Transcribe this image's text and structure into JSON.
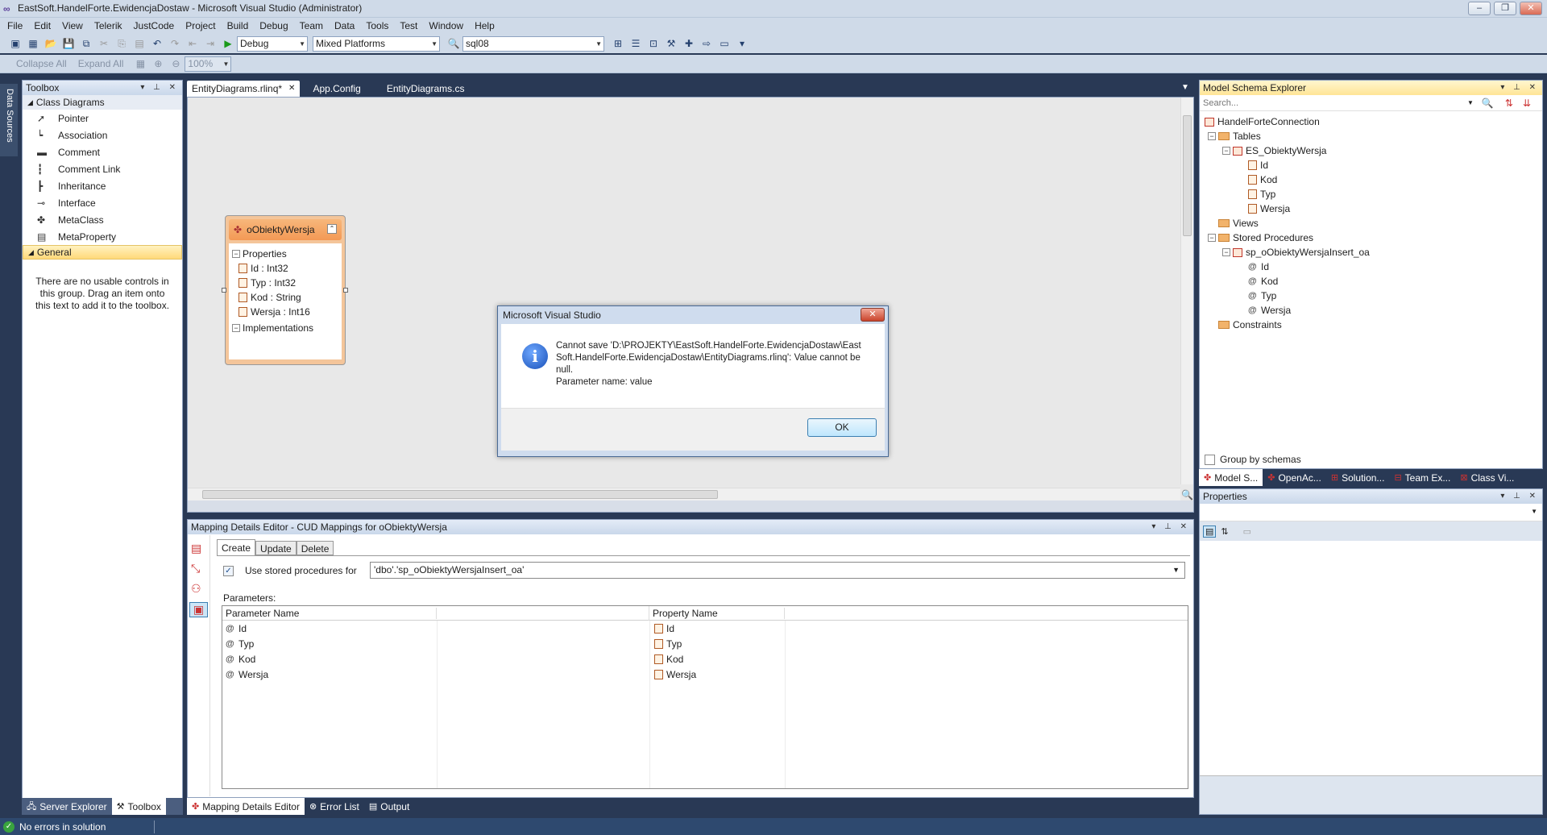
{
  "window": {
    "title": "EastSoft.HandelForte.EwidencjaDostaw - Microsoft Visual Studio (Administrator)",
    "controls": [
      "–",
      "❐",
      "✕"
    ]
  },
  "menu": [
    "File",
    "Edit",
    "View",
    "Telerik",
    "JustCode",
    "Project",
    "Build",
    "Debug",
    "Team",
    "Data",
    "Tools",
    "Test",
    "Window",
    "Help"
  ],
  "toolbar": {
    "config": "Debug",
    "platform": "Mixed Platforms",
    "search": "sql08",
    "collapse_all": "Collapse All",
    "expand_all": "Expand All",
    "zoom": "100%"
  },
  "side_strip": {
    "label": "Data Sources"
  },
  "toolbox": {
    "title": "Toolbox",
    "group1": "Class Diagrams",
    "items": [
      {
        "icon": "pointer-icon",
        "glyph": "➚",
        "label": "Pointer"
      },
      {
        "icon": "association-icon",
        "glyph": "┕",
        "label": "Association"
      },
      {
        "icon": "comment-icon",
        "glyph": "▬",
        "label": "Comment"
      },
      {
        "icon": "comment-link-icon",
        "glyph": "┇",
        "label": "Comment Link"
      },
      {
        "icon": "inheritance-icon",
        "glyph": "┣",
        "label": "Inheritance"
      },
      {
        "icon": "interface-icon",
        "glyph": "⊸",
        "label": "Interface"
      },
      {
        "icon": "metaclass-icon",
        "glyph": "✤",
        "label": "MetaClass"
      },
      {
        "icon": "metaproperty-icon",
        "glyph": "▤",
        "label": "MetaProperty"
      }
    ],
    "group2": "General",
    "empty_text": "There are no usable controls in this group. Drag an item onto this text to add it to the toolbox.",
    "bottom_tabs": [
      "Server Explorer",
      "Toolbox"
    ]
  },
  "doc_tabs": [
    {
      "label": "EntityDiagrams.rlinq*",
      "active": true
    },
    {
      "label": "App.Config",
      "active": false
    },
    {
      "label": "EntityDiagrams.cs",
      "active": false
    }
  ],
  "entity": {
    "name": "oObiektyWersja",
    "properties_label": "Properties",
    "properties": [
      "Id : Int32",
      "Typ : Int32",
      "Kod : String",
      "Wersja : Int16"
    ],
    "implementations_label": "Implementations"
  },
  "dialog": {
    "title": "Microsoft Visual Studio",
    "message": "Cannot save 'D:\\PROJEKTY\\EastSoft.HandelForte.EwidencjaDostaw\\EastSoft.HandelForte.EwidencjaDostaw\\EntityDiagrams.rlinq': Value cannot be null.\nParameter name: value",
    "ok": "OK"
  },
  "mapping": {
    "title": "Mapping Details Editor - CUD Mappings for  oObiektyWersja",
    "tabs": [
      "Create",
      "Update",
      "Delete"
    ],
    "use_sp_label": "Use stored procedures for",
    "sp_value": "'dbo'.'sp_oObiektyWersjaInsert_oa'",
    "parameters_label": "Parameters:",
    "col_param": "Parameter Name",
    "col_prop": "Property Name",
    "rows": [
      {
        "param": "Id",
        "prop": "Id"
      },
      {
        "param": "Typ",
        "prop": "Typ"
      },
      {
        "param": "Kod",
        "prop": "Kod"
      },
      {
        "param": "Wersja",
        "prop": "Wersja"
      }
    ]
  },
  "bottom_tabs": [
    "Mapping Details Editor",
    "Error List",
    "Output"
  ],
  "schema": {
    "title": "Model Schema Explorer",
    "search_placeholder": "Search...",
    "connection": "HandelForteConnection",
    "tables": "Tables",
    "table_name": "ES_ObiektyWersja",
    "table_fields": [
      "Id",
      "Kod",
      "Typ",
      "Wersja"
    ],
    "views": "Views",
    "stored_procedures": "Stored Procedures",
    "sp_name": "sp_oObiektyWersjaInsert_oa",
    "sp_params": [
      "Id",
      "Kod",
      "Typ",
      "Wersja"
    ],
    "constraints": "Constraints",
    "group_by": "Group by schemas",
    "tabs": [
      "Model S...",
      "OpenAc...",
      "Solution...",
      "Team Ex...",
      "Class Vi..."
    ]
  },
  "properties": {
    "title": "Properties"
  },
  "status": {
    "text": "No errors in solution"
  }
}
